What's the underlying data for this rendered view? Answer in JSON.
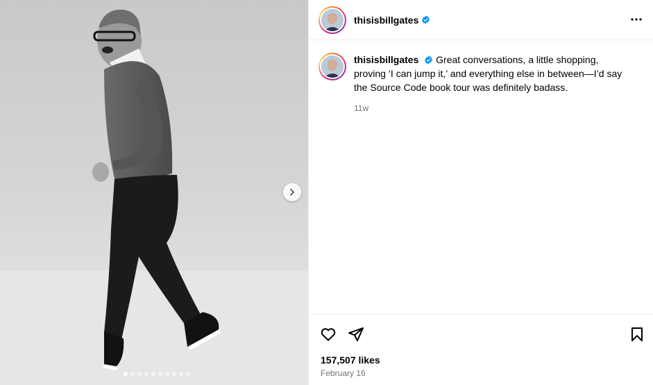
{
  "post": {
    "username": "thisisbillgates",
    "caption": "Great conversations, a little shopping, proving ‘I can jump it,’ and everything else in between—I’d say the Source Code book tour was definitely badass.",
    "time_ago": "11w",
    "likes": "157,507 likes",
    "date": "February 16"
  },
  "icons": {
    "verified": "verified-badge-icon",
    "more": "more-options-icon",
    "like": "heart-icon",
    "share": "paper-plane-icon",
    "save": "bookmark-icon",
    "next": "chevron-right-icon"
  },
  "carousel": {
    "slides": 10,
    "active_index": 0
  },
  "colors": {
    "verified": "#0095f6",
    "muted": "#737373"
  }
}
